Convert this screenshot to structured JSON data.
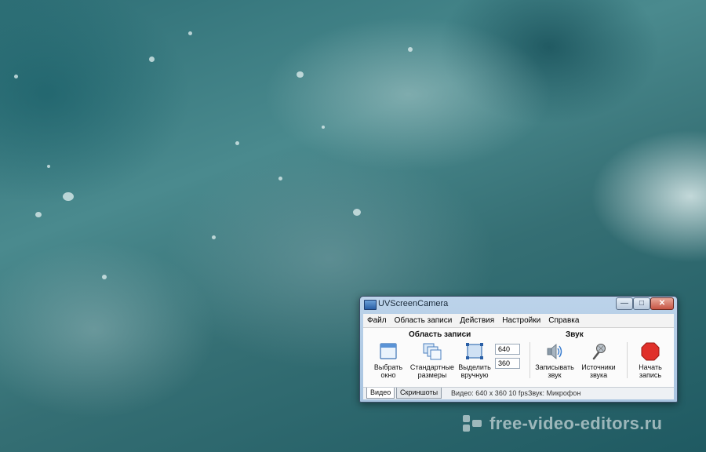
{
  "window": {
    "title": "UVScreenCamera",
    "min_label": "—",
    "max_label": "□",
    "close_label": "✕"
  },
  "menu": [
    "Файл",
    "Область записи",
    "Действия",
    "Настройки",
    "Справка"
  ],
  "recording_area": {
    "title": "Область записи",
    "choose_window": [
      "Выбрать",
      "окно"
    ],
    "standard_sizes": [
      "Стандартные",
      "размеры"
    ],
    "select_manual": [
      "Выделить",
      "вручную"
    ],
    "width": "640",
    "height": "360"
  },
  "sound": {
    "title": "Звук",
    "record_sound": [
      "Записывать",
      "звук"
    ],
    "sources": [
      "Источники",
      "звука"
    ]
  },
  "start": [
    "Начать",
    "запись"
  ],
  "tabs": [
    "Видео",
    "Скриншоты"
  ],
  "status": {
    "video": "Видео: 640 x 360  10 fps",
    "sound": "Звук: Микрофон"
  },
  "watermark": "free-video-editors.ru",
  "colors": {
    "accent": "#2a5fa6",
    "record": "#e0302a"
  }
}
